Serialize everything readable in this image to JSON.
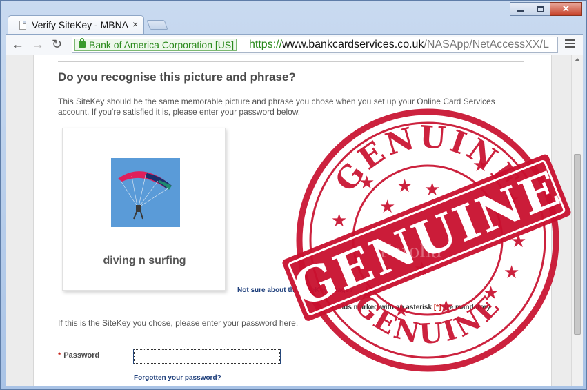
{
  "window": {
    "tab_title": "Verify SiteKey - MBNA",
    "tab_close": "×"
  },
  "toolbar": {
    "ev_label": "Bank of America Corporation [US]",
    "url_scheme": "https://",
    "url_host": "www.bankcardservices.co.uk",
    "url_path": "/NASApp/NetAccessXX/L",
    "back": "←",
    "forward": "→",
    "reload": "↻",
    "star": "☆"
  },
  "page": {
    "heading": "Do you recognise this picture and phrase?",
    "intro": "This SiteKey should be the same memorable picture and phrase you chose when you set up your Online Card Services account. If you're satisfied it is, please enter your password below.",
    "sitekey_phrase": "diving n surfing",
    "not_sure_link": "Not sure about this SiteKey image?",
    "required_note_prefix": "Fields marked with an asterisk ",
    "required_note_ast": "[*]",
    "required_note_suffix": " are mandatory",
    "password_prompt": "If this is the SiteKey you chose, please enter your password here.",
    "password_label": "Password",
    "password_ast": "*",
    "password_value": "",
    "forgot_link": "Forgotten your password?"
  },
  "stamp": {
    "top_arc_text": "GENUINE",
    "band_text": "GENUINE",
    "bottom_arc_text": "GENUINE",
    "watermark": "Fotolia",
    "color": "#c8102e"
  },
  "colors": {
    "link": "#1c3d7a",
    "ev_green": "#2b8a1d",
    "asterisk": "#c7241a"
  }
}
